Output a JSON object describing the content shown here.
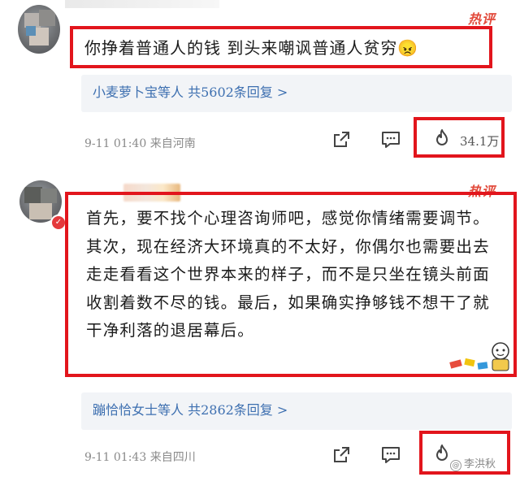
{
  "comments": [
    {
      "hot_label": "热评",
      "text": "你挣着普通人的钱 到头来嘲讽普通人贫穷",
      "emoji": "😠",
      "replies_text": "小麦萝卜宝等人 共5602条回复 >",
      "meta": "9-11 01:40 来自河南",
      "likes": "34.1万"
    },
    {
      "hot_label": "热评",
      "text": "首先，要不找个心理咨询师吧，感觉你情绪需要调节。其次，现在经济大环境真的不太好，你偶尔也需要出去走走看看这个世界本来的样子，而不是只坐在镜头前面收割着数不尽的钱。最后，如果确实挣够钱不想干了就干净利落的退居幕后。",
      "replies_text": "蹦恰恰女士等人 共2862条回复 >",
      "meta": "9-11 01:43 来自四川",
      "likes": ""
    }
  ],
  "watermark": "李洪秋",
  "icons": [
    "share-icon",
    "comment-icon",
    "like-flame-icon"
  ],
  "colors": {
    "highlight_box": "#e2151c",
    "hot_label": "#e24a3b",
    "reply_link": "#3d6fb0",
    "reply_bg": "#f2f4f7"
  }
}
